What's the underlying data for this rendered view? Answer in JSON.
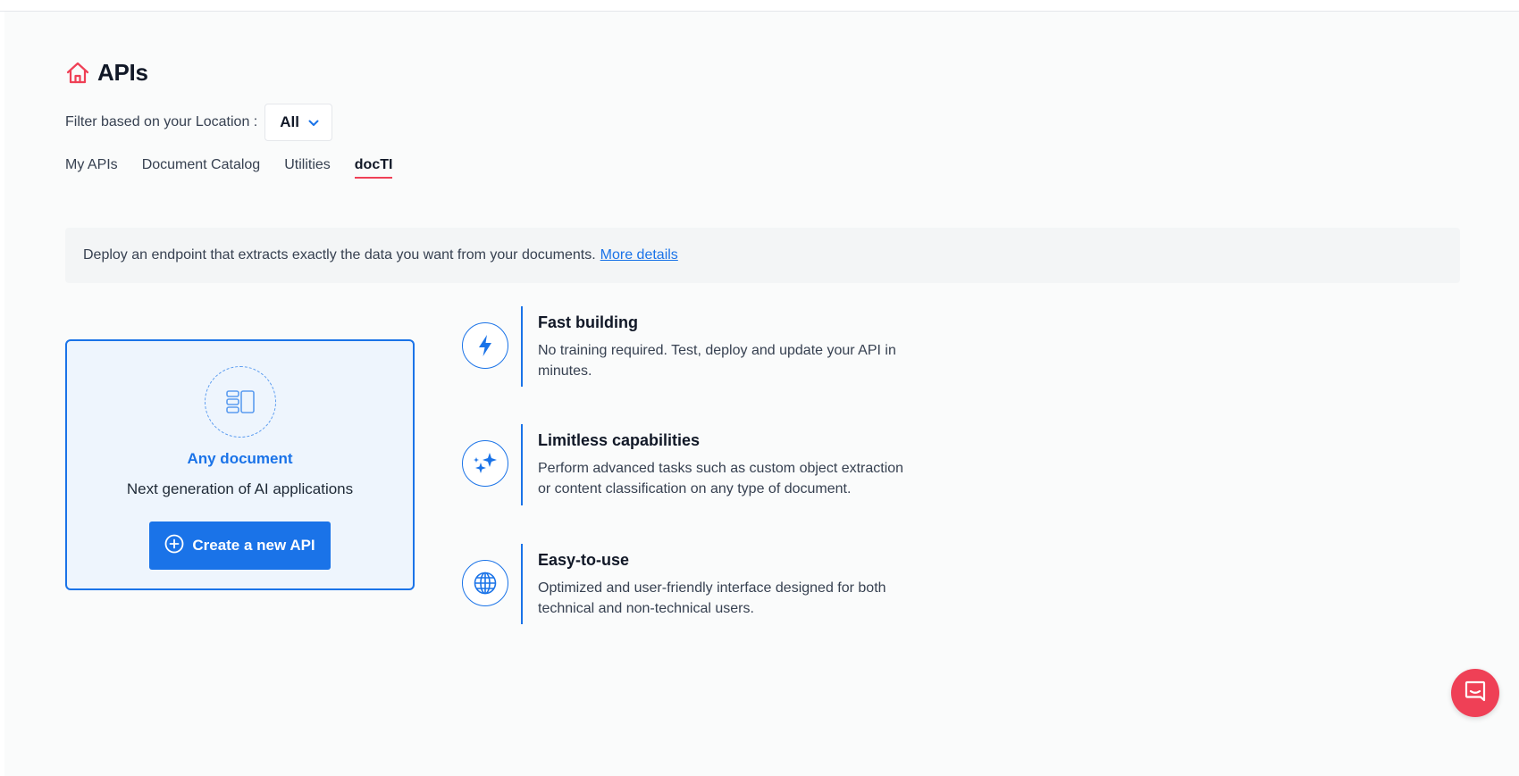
{
  "header": {
    "title": "APIs",
    "icon": "home-icon"
  },
  "filter": {
    "label": "Filter based on your Location :",
    "selected": "All"
  },
  "tabs": [
    {
      "label": "My APIs",
      "active": false
    },
    {
      "label": "Document Catalog",
      "active": false
    },
    {
      "label": "Utilities",
      "active": false
    },
    {
      "label": "docTI",
      "active": true
    }
  ],
  "banner": {
    "text": "Deploy an endpoint that extracts exactly the data you want from your documents.",
    "link": "More details"
  },
  "card": {
    "icon": "document-layout-icon",
    "title": "Any document",
    "subtitle": "Next generation of AI applications",
    "button_label": "Create a new API"
  },
  "features": [
    {
      "icon": "lightning-icon",
      "title": "Fast building",
      "description": "No training required. Test, deploy and update your API in minutes."
    },
    {
      "icon": "sparkles-icon",
      "title": "Limitless capabilities",
      "description": "Perform advanced tasks such as custom object extraction or content classification on any type of document."
    },
    {
      "icon": "globe-icon",
      "title": "Easy-to-use",
      "description": "Optimized and user-friendly interface designed for both technical and non-technical users."
    }
  ],
  "colors": {
    "accent": "#1a73e8",
    "brand": "#ef4056",
    "background": "#fafbfb"
  }
}
